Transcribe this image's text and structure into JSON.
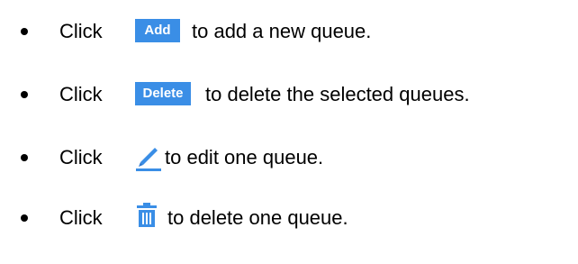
{
  "items": [
    {
      "prefix": "Click",
      "button_label": "Add",
      "suffix": "to add a new queue."
    },
    {
      "prefix": "Click",
      "button_label": "Delete",
      "suffix": "to delete the selected queues."
    },
    {
      "prefix": "Click",
      "icon": "edit-pencil-icon",
      "suffix": "to edit one queue."
    },
    {
      "prefix": "Click",
      "icon": "trash-icon",
      "suffix": "to delete one queue."
    }
  ],
  "colors": {
    "button_background": "#3a8ee6",
    "button_text": "#ffffff",
    "icon_accent": "#3a8ee6"
  }
}
